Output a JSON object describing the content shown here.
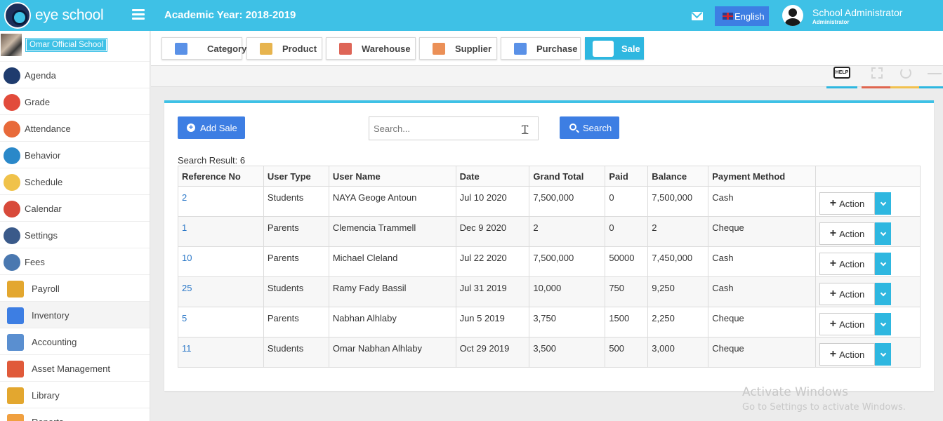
{
  "app": {
    "brand": "eye school",
    "academic_year": "Academic Year: 2018-2019"
  },
  "header": {
    "language": "English",
    "user_name": "School Administrator",
    "user_role": "Administrator"
  },
  "sidebar": {
    "school_name": "Omar Official School",
    "items": [
      {
        "label": "Agenda",
        "icon": "agenda-icon",
        "color": "#1f3c6e"
      },
      {
        "label": "Grade",
        "icon": "grade-icon",
        "color": "#e24b3b"
      },
      {
        "label": "Attendance",
        "icon": "attendance-icon",
        "color": "#e86a3a"
      },
      {
        "label": "Behavior",
        "icon": "behavior-icon",
        "color": "#2a88c9"
      },
      {
        "label": "Schedule",
        "icon": "schedule-icon",
        "color": "#f0c24a"
      },
      {
        "label": "Calendar",
        "icon": "calendar-icon",
        "color": "#d84a3a"
      },
      {
        "label": "Settings",
        "icon": "settings-icon",
        "color": "#3a5a8a"
      },
      {
        "label": "Fees",
        "icon": "fees-icon",
        "color": "#4a78b0"
      },
      {
        "label": "Payroll",
        "icon": "payroll-icon",
        "color": "#e3a72f"
      },
      {
        "label": "Inventory",
        "icon": "inventory-icon",
        "color": "#3d7ee3"
      },
      {
        "label": "Accounting",
        "icon": "accounting-icon",
        "color": "#5a8fd0"
      },
      {
        "label": "Asset Management",
        "icon": "asset-management-icon",
        "color": "#e05a3a"
      },
      {
        "label": "Library",
        "icon": "library-icon",
        "color": "#e3a72f"
      },
      {
        "label": "Reports",
        "icon": "reports-icon",
        "color": "#f0a040"
      }
    ]
  },
  "tabs": [
    {
      "label": "Category",
      "icon": "category-icon"
    },
    {
      "label": "Product",
      "icon": "product-icon"
    },
    {
      "label": "Warehouse",
      "icon": "warehouse-icon"
    },
    {
      "label": "Supplier",
      "icon": "supplier-icon"
    },
    {
      "label": "Purchase",
      "icon": "purchase-icon"
    },
    {
      "label": "Sale",
      "icon": "sale-icon"
    }
  ],
  "tools": {
    "help_label": "HELP",
    "colors": [
      "#2eb7e0",
      "#e0664f",
      "#f2c14e",
      "#2eb7e0"
    ]
  },
  "sale": {
    "add_label": "Add Sale",
    "search_placeholder": "Search...",
    "search_label": "Search",
    "result_label": "Search Result: 6",
    "columns": [
      "Reference No",
      "User Type",
      "User Name",
      "Date",
      "Grand Total",
      "Paid",
      "Balance",
      "Payment Method",
      ""
    ],
    "rows": [
      [
        "2",
        "Students",
        "NAYA Geoge Antoun",
        "Jul 10 2020",
        "7,500,000",
        "0",
        "7,500,000",
        "Cash"
      ],
      [
        "1",
        "Parents",
        "Clemencia Trammell",
        "Dec 9 2020",
        "2",
        "0",
        "2",
        "Cheque"
      ],
      [
        "10",
        "Parents",
        "Michael Cleland",
        "Jul 22 2020",
        "7,500,000",
        "50000",
        "7,450,000",
        "Cash"
      ],
      [
        "25",
        "Students",
        "Ramy Fady Bassil",
        "Jul 31 2019",
        "10,000",
        "750",
        "9,250",
        "Cash"
      ],
      [
        "5",
        "Parents",
        "Nabhan Alhlaby",
        "Jun 5 2019",
        "3,750",
        "1500",
        "2,250",
        "Cheque"
      ],
      [
        "11",
        "Students",
        "Omar Nabhan Alhlaby",
        "Oct 29 2019",
        "3,500",
        "500",
        "3,000",
        "Cheque"
      ]
    ],
    "action_label": "Action"
  },
  "watermark": {
    "line1": "Activate Windows",
    "line2": "Go to Settings to activate Windows."
  }
}
